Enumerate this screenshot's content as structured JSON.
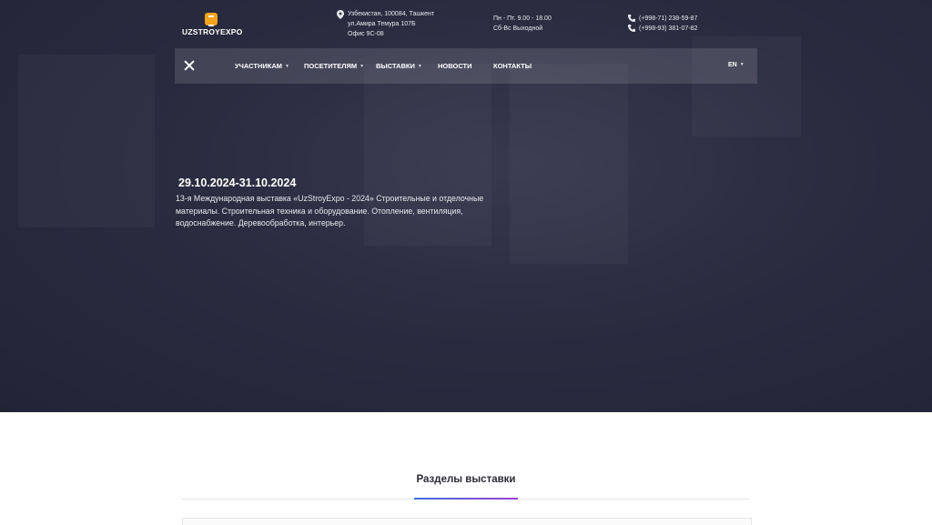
{
  "logo": {
    "text": "UZSTROYEXPO"
  },
  "contact": {
    "address": [
      "Узбекистан, 100084, Ташкент",
      "ул.Амира Темура 107Б",
      "Офис 9С-08"
    ],
    "hours": [
      "Пн - Пт. 9.00 - 18.00",
      "Сб-Вс Выходной"
    ],
    "phones": [
      "(+998-71) 238-59-87",
      "(+998-93) 381-07-82"
    ]
  },
  "nav": {
    "items": [
      "УЧАСТНИКАМ",
      "ПОСЕТИТЕЛЯМ",
      "ВЫСТАВКИ",
      "НОВОСТИ",
      "КОНТАКТЫ"
    ],
    "language": "EN"
  },
  "hero": {
    "date": "29.10.2024-31.10.2024",
    "description": "13-я Международная выставка «UzStroyExpo - 2024» Строительные и отделочные материалы. Строительная техника и оборудование. Отопление, вентиляция, водоснабжение. Деревообработка, интерьер."
  },
  "sections": {
    "title": "Разделы выставки"
  },
  "colors": {
    "accent": "#f2a31b",
    "gradient_start": "#3b6fe0",
    "gradient_end": "#9b3fd0"
  }
}
